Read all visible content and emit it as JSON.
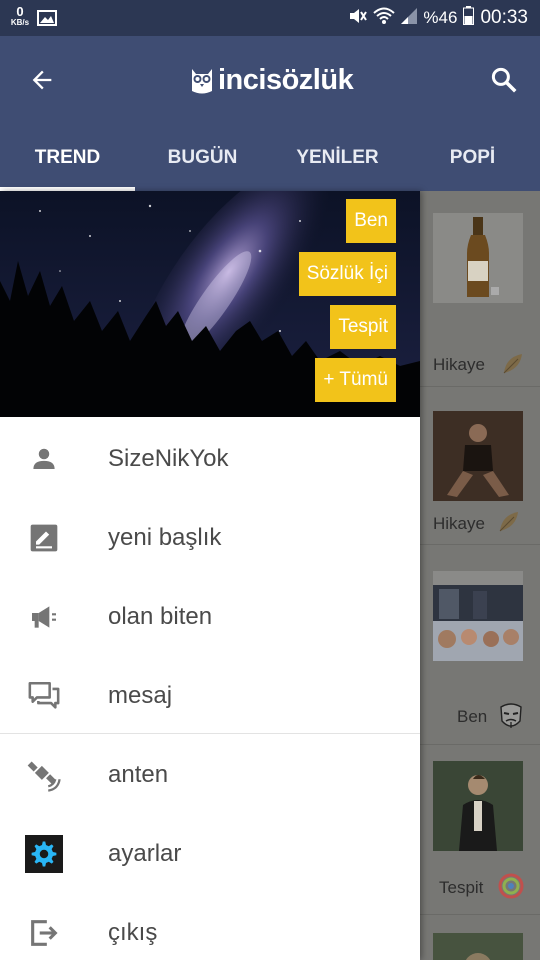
{
  "status_bar": {
    "net_speed_value": "0",
    "net_speed_unit": "KB/s",
    "battery_text": "%46",
    "time": "00:33"
  },
  "app_bar": {
    "logo_text": "incisözlük",
    "tabs": [
      {
        "label": "TREND",
        "active": true
      },
      {
        "label": "BUGÜN",
        "active": false
      },
      {
        "label": "YENİLER",
        "active": false
      },
      {
        "label": "POPİ",
        "active": false
      }
    ]
  },
  "drawer": {
    "header_chips": [
      "Ben",
      "Sözlük İçi",
      "Tespit",
      "+ Tümü"
    ],
    "menu": [
      {
        "label": "SizeNikYok",
        "icon": "person-icon"
      },
      {
        "label": "yeni başlık",
        "icon": "edit-icon"
      },
      {
        "label": "olan biten",
        "icon": "megaphone-icon"
      },
      {
        "label": "mesaj",
        "icon": "chat-icon"
      },
      {
        "label": "anten",
        "icon": "satellite-icon"
      },
      {
        "label": "ayarlar",
        "icon": "gear-icon"
      },
      {
        "label": "çıkış",
        "icon": "logout-icon"
      }
    ]
  },
  "feed": {
    "cards": [
      {
        "label": "Hikaye",
        "badge": "feather-icon"
      },
      {
        "label": "Hikaye",
        "badge": "feather-icon"
      },
      {
        "label": "Ben",
        "badge": "mask-icon"
      },
      {
        "label": "Tespit",
        "badge": "rainbow-circle-icon"
      }
    ]
  },
  "colors": {
    "status_bar": "#2c3753",
    "app_bar": "#3f4d73",
    "chip": "#f2c31a",
    "settings_icon": "#29b6f6"
  }
}
